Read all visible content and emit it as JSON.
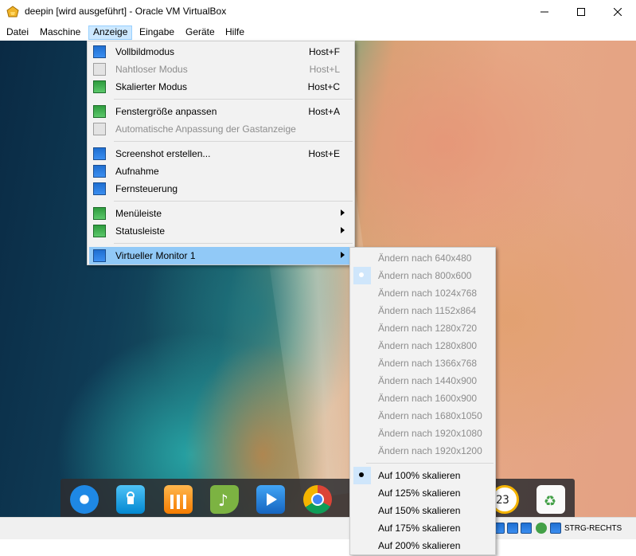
{
  "window": {
    "title": "deepin [wird ausgeführt] - Oracle VM VirtualBox"
  },
  "menubar": {
    "items": [
      "Datei",
      "Maschine",
      "Anzeige",
      "Eingabe",
      "Geräte",
      "Hilfe"
    ],
    "active": "Anzeige"
  },
  "anzeige_menu": {
    "items": [
      {
        "label": "Vollbildmodus",
        "shortcut": "Host+F",
        "enabled": true,
        "icon": "fullscreen-icon"
      },
      {
        "label": "Nahtloser Modus",
        "shortcut": "Host+L",
        "enabled": false,
        "icon": "seamless-icon"
      },
      {
        "label": "Skalierter Modus",
        "shortcut": "Host+C",
        "enabled": true,
        "icon": "scaled-icon"
      },
      {
        "label": "Fenstergröße anpassen",
        "shortcut": "Host+A",
        "enabled": true,
        "icon": "adjust-window-icon"
      },
      {
        "label": "Automatische Anpassung der Gastanzeige",
        "shortcut": "",
        "enabled": false,
        "icon": "auto-resize-icon"
      },
      {
        "label": "Screenshot erstellen...",
        "shortcut": "Host+E",
        "enabled": true,
        "icon": "screenshot-icon"
      },
      {
        "label": "Aufnahme",
        "shortcut": "",
        "enabled": true,
        "icon": "recording-icon"
      },
      {
        "label": "Fernsteuerung",
        "shortcut": "",
        "enabled": true,
        "icon": "remote-display-icon"
      },
      {
        "label": "Menüleiste",
        "shortcut": "",
        "enabled": true,
        "icon": "menubar-icon",
        "submenu": true
      },
      {
        "label": "Statusleiste",
        "shortcut": "",
        "enabled": true,
        "icon": "statusbar-icon",
        "submenu": true
      },
      {
        "label": "Virtueller Monitor 1",
        "shortcut": "",
        "enabled": true,
        "icon": "virtual-monitor-icon",
        "submenu": true,
        "highlighted": true
      }
    ]
  },
  "monitor_menu": {
    "resolutions": [
      "Ändern nach 640x480",
      "Ändern nach 800x600",
      "Ändern nach 1024x768",
      "Ändern nach 1152x864",
      "Ändern nach 1280x720",
      "Ändern nach 1280x800",
      "Ändern nach 1366x768",
      "Ändern nach 1440x900",
      "Ändern nach 1600x900",
      "Ändern nach 1680x1050",
      "Ändern nach 1920x1080",
      "Ändern nach 1920x1200"
    ],
    "selected_resolution": "Ändern nach 800x600",
    "scales": [
      "Auf 100% skalieren",
      "Auf 125% skalieren",
      "Auf 150% skalieren",
      "Auf 175% skalieren",
      "Auf 200% skalieren"
    ],
    "selected_scale": "Auf 100% skalieren"
  },
  "dock": {
    "icons": [
      "deepin-launcher-icon",
      "app-store-icon",
      "shop-icon",
      "music-icon",
      "video-icon",
      "chrome-icon",
      "clock-icon",
      "trash-icon"
    ],
    "clock_text": "23"
  },
  "statusbar": {
    "host_key": "STRG-RECHTS"
  },
  "colors": {
    "menu_highlight": "#91c9f7",
    "menubar_active": "#cce8ff",
    "menu_bg": "#f2f2f2"
  }
}
